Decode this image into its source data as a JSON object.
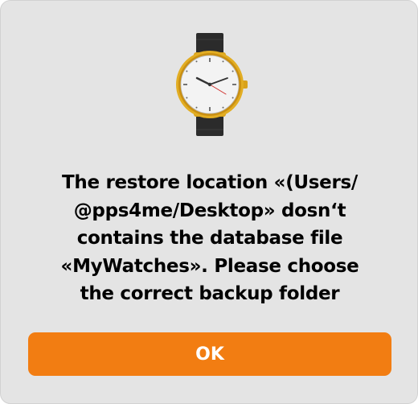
{
  "dialog": {
    "icon": "wristwatch-icon",
    "message": "The restore location «(Users/\n@pps4me/Desktop» dosn‘t\ncontains the database file\n«MyWatches». Please choose\nthe correct backup folder",
    "ok_label": "OK"
  },
  "colors": {
    "dialog_background": "#e4e4e4",
    "button": "#f27d12",
    "button_text": "#ffffff",
    "text": "#000000"
  }
}
